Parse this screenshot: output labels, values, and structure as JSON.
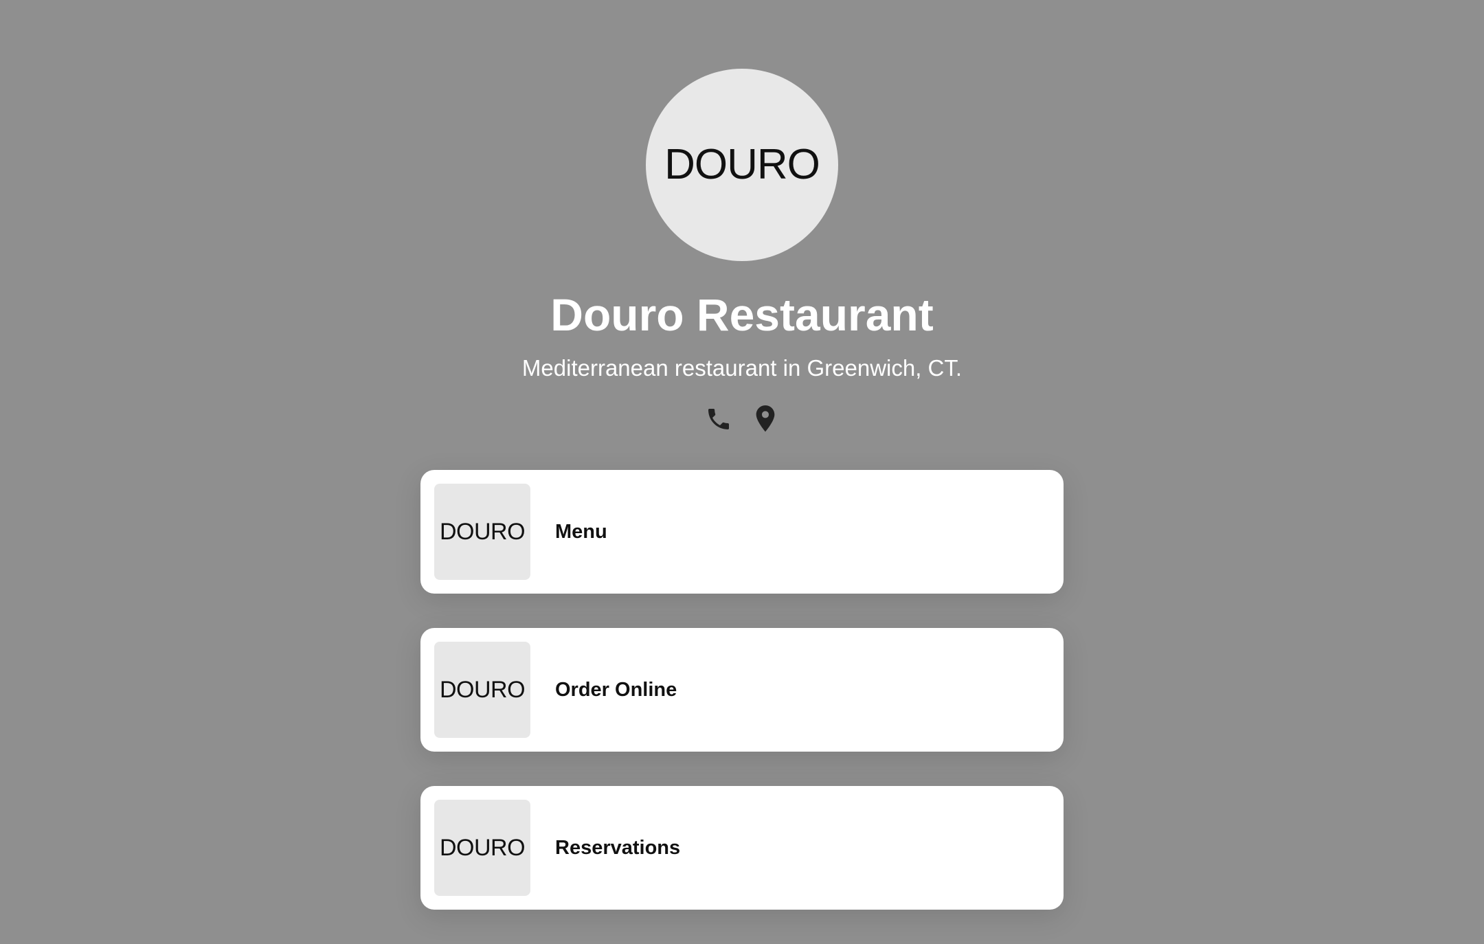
{
  "profile": {
    "avatar_logo": "DOURO",
    "title": "Douro Restaurant",
    "subtitle": "Mediterranean restaurant in Greenwich, CT."
  },
  "social": [
    {
      "icon": "phone-icon"
    },
    {
      "icon": "location-pin-icon"
    }
  ],
  "links": [
    {
      "label": "Menu",
      "thumb_logo": "DOURO"
    },
    {
      "label": "Order Online",
      "thumb_logo": "DOURO"
    },
    {
      "label": "Reservations",
      "thumb_logo": "DOURO"
    }
  ],
  "colors": {
    "background": "#8f8f8f",
    "card": "#ffffff",
    "thumb": "#e7e7e7",
    "text_light": "#ffffff",
    "text_dark": "#111111"
  }
}
